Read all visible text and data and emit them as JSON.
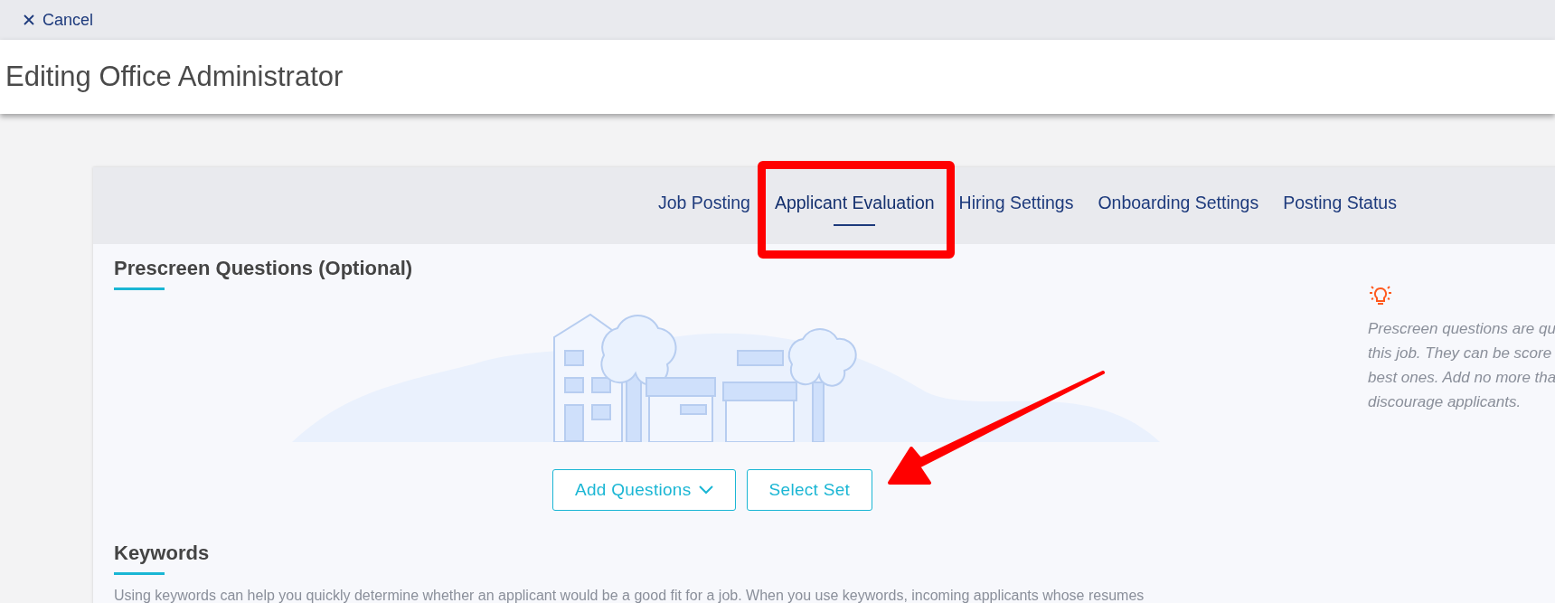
{
  "top_bar": {
    "cancel": "Cancel"
  },
  "page_title": "Editing Office Administrator",
  "tabs": [
    {
      "label": "Job Posting",
      "selected": false
    },
    {
      "label": "Applicant Evaluation",
      "selected": true
    },
    {
      "label": "Hiring Settings",
      "selected": false
    },
    {
      "label": "Onboarding Settings",
      "selected": false
    },
    {
      "label": "Posting Status",
      "selected": false
    }
  ],
  "prescreen": {
    "heading": "Prescreen Questions (Optional)",
    "buttons": [
      {
        "label": "Add Questions",
        "dropdown": true
      },
      {
        "label": "Select Set",
        "dropdown": false
      }
    ]
  },
  "tip": {
    "lines": [
      "Prescreen questions are qu",
      "this job. They can be score",
      "best ones. Add no more tha",
      "discourage applicants."
    ]
  },
  "keywords": {
    "heading": "Keywords",
    "text": "Using keywords can help you quickly determine whether an applicant would be a good fit for a job. When you use keywords, incoming applicants whose resumes"
  }
}
